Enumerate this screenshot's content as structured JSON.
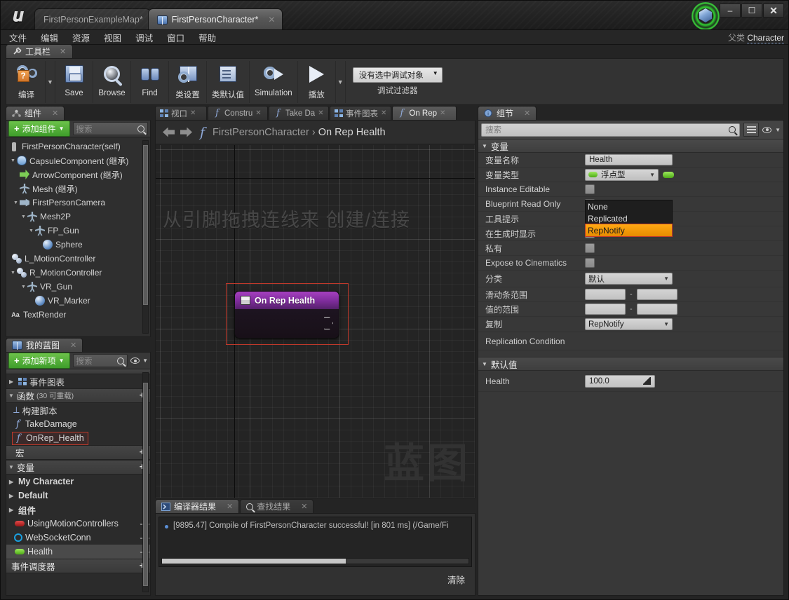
{
  "titlebar": {
    "logo": "ue-logo",
    "tabs": [
      {
        "label": "FirstPersonExampleMap*",
        "active": false,
        "icon": null
      },
      {
        "label": "FirstPersonCharacter*",
        "active": true,
        "icon": "blueprint-icon"
      }
    ],
    "window_buttons": {
      "minimize": "–",
      "maximize": "❐",
      "close": "✕"
    }
  },
  "menubar": {
    "items": [
      "文件",
      "编辑",
      "资源",
      "视图",
      "调试",
      "窗口",
      "帮助"
    ]
  },
  "parent_class": {
    "label": "父类",
    "value": "Character"
  },
  "toolbar": {
    "tab_label": "工具栏",
    "items": [
      {
        "label": "编译",
        "icon": "compile-icon",
        "has_caret": true
      },
      {
        "label": "Save",
        "icon": "save-icon"
      },
      {
        "label": "Browse",
        "icon": "browse-icon"
      },
      {
        "label": "Find",
        "icon": "find-icon"
      },
      {
        "label": "类设置",
        "icon": "class-settings-icon"
      },
      {
        "label": "类默认值",
        "icon": "class-defaults-icon"
      },
      {
        "label": "Simulation",
        "icon": "simulation-icon"
      },
      {
        "label": "播放",
        "icon": "play-icon",
        "has_caret": true
      }
    ],
    "debug": {
      "selected": "没有选中调试对象",
      "caption": "调试过滤器"
    }
  },
  "components": {
    "tab_label": "组件",
    "add_button": "添加组件",
    "search_placeholder": "搜索",
    "tree": [
      {
        "label": "FirstPersonCharacter(self)",
        "depth": 0,
        "icon": "self-icon",
        "arrow": ""
      },
      {
        "label": "CapsuleComponent (继承)",
        "depth": 0,
        "icon": "capsule-icon",
        "arrow": "▼"
      },
      {
        "label": "ArrowComponent (继承)",
        "depth": 1,
        "icon": "arrow-component-icon",
        "arrow": ""
      },
      {
        "label": "Mesh (继承)",
        "depth": 1,
        "icon": "mesh-icon",
        "arrow": ""
      },
      {
        "label": "FirstPersonCamera",
        "depth": 1,
        "icon": "camera-icon",
        "arrow": "▼"
      },
      {
        "label": "Mesh2P",
        "depth": 2,
        "icon": "mesh-icon",
        "arrow": "▼"
      },
      {
        "label": "FP_Gun",
        "depth": 3,
        "icon": "mesh-icon",
        "arrow": "▼"
      },
      {
        "label": "Sphere",
        "depth": 4,
        "icon": "sphere-icon",
        "arrow": ""
      },
      {
        "label": "L_MotionController",
        "depth": 1,
        "icon": "motion-controller-icon",
        "arrow": ""
      },
      {
        "label": "R_MotionController",
        "depth": 1,
        "icon": "motion-controller-icon",
        "arrow": "▼"
      },
      {
        "label": "VR_Gun",
        "depth": 2,
        "icon": "mesh-icon",
        "arrow": "▼"
      },
      {
        "label": "VR_Marker",
        "depth": 3,
        "icon": "sphere-icon",
        "arrow": ""
      },
      {
        "label": "TextRender",
        "depth": 1,
        "icon": "text-render-icon",
        "arrow": ""
      }
    ]
  },
  "myblueprint": {
    "tab_label": "我的蓝图",
    "add_button": "添加新项",
    "search_placeholder": "搜索",
    "rows": [
      {
        "type": "item",
        "label": "事件图表",
        "icon": "graph-icon",
        "arrow": "▷"
      },
      {
        "type": "section",
        "label": "函数",
        "note": "(30 可重载)",
        "arrow": "▼",
        "add": "+"
      },
      {
        "type": "item",
        "label": "构建脚本",
        "icon": "construction-script-icon"
      },
      {
        "type": "item",
        "label": "TakeDamage",
        "icon": "function-icon"
      },
      {
        "type": "item",
        "label": "OnRep_Health",
        "icon": "function-icon",
        "highlight": true
      },
      {
        "type": "section",
        "label": "宏",
        "arrow": "",
        "add": "+"
      },
      {
        "type": "section",
        "label": "变量",
        "arrow": "▼",
        "add": "+"
      },
      {
        "type": "category",
        "label": "My Character",
        "arrow": "▷"
      },
      {
        "type": "category",
        "label": "Default",
        "arrow": "▷"
      },
      {
        "type": "category",
        "label": "组件",
        "arrow": "▷"
      },
      {
        "type": "var",
        "label": "UsingMotionControllers",
        "color": "#c8202a",
        "shape": "pill",
        "rep": true
      },
      {
        "type": "var",
        "label": "WebSocketConn",
        "color": "#1aa0e0",
        "shape": "circle",
        "rep": true
      },
      {
        "type": "var",
        "label": "Health",
        "color": "#6fce2f",
        "shape": "pill",
        "rep": true,
        "selected": true
      },
      {
        "type": "section",
        "label": "事件调度器",
        "arrow": "",
        "add": "+"
      }
    ]
  },
  "graph": {
    "tabs": [
      {
        "label": "视口",
        "icon": "viewport-icon",
        "active": false
      },
      {
        "label": "Constru",
        "icon": "function-icon",
        "active": false
      },
      {
        "label": "Take Da",
        "icon": "function-icon",
        "active": false
      },
      {
        "label": "事件图表",
        "icon": "graph-icon",
        "active": false
      },
      {
        "label": "On Rep",
        "icon": "function-icon",
        "active": true
      }
    ],
    "breadcrumb": {
      "root": "FirstPersonCharacter",
      "sep": "›",
      "current": "On Rep Health"
    },
    "hint": "从引脚拖拽连线来 创建/连接",
    "watermark": "蓝图",
    "node": {
      "title": "On Rep Health",
      "selected": true
    }
  },
  "results": {
    "tabs": [
      {
        "label": "编译器结果",
        "icon": "compiler-icon",
        "active": true
      },
      {
        "label": "查找结果",
        "icon": "search-icon",
        "active": false
      }
    ],
    "message": "[9895.47] Compile of FirstPersonCharacter successful! [in 801 ms] (/Game/Fi",
    "clear_button": "清除"
  },
  "details": {
    "tab_label": "组节",
    "search_placeholder": "搜索",
    "section_variable": "变量",
    "section_defaults": "默认值",
    "properties": [
      {
        "label": "变量名称",
        "type": "text",
        "value": "Health"
      },
      {
        "label": "变量类型",
        "type": "typecombo",
        "value": "浮点型",
        "color": "#6fce2f"
      },
      {
        "label": "Instance Editable",
        "type": "checkbox",
        "value": false
      },
      {
        "label": "Blueprint Read Only",
        "type": "checkbox",
        "value": false
      },
      {
        "label": "工具提示",
        "type": "text",
        "value": ""
      },
      {
        "label": "在生成时显示",
        "type": "checkbox",
        "value": false
      },
      {
        "label": "私有",
        "type": "checkbox",
        "value": false
      },
      {
        "label": "Expose to Cinematics",
        "type": "checkbox",
        "value": false
      },
      {
        "label": "分类",
        "type": "combo",
        "value": "默认"
      },
      {
        "label": "滑动条范围",
        "type": "range",
        "min": "",
        "max": ""
      },
      {
        "label": "值的范围",
        "type": "range",
        "min": "",
        "max": ""
      },
      {
        "label": "复制",
        "type": "combo",
        "value": "RepNotify"
      },
      {
        "label": "Replication Condition",
        "type": "blank",
        "value": ""
      }
    ],
    "dropdown": {
      "open": true,
      "options": [
        "None",
        "Replicated",
        "RepNotify"
      ],
      "selected": "RepNotify"
    },
    "default_value": {
      "label": "Health",
      "value": "100.0"
    }
  }
}
